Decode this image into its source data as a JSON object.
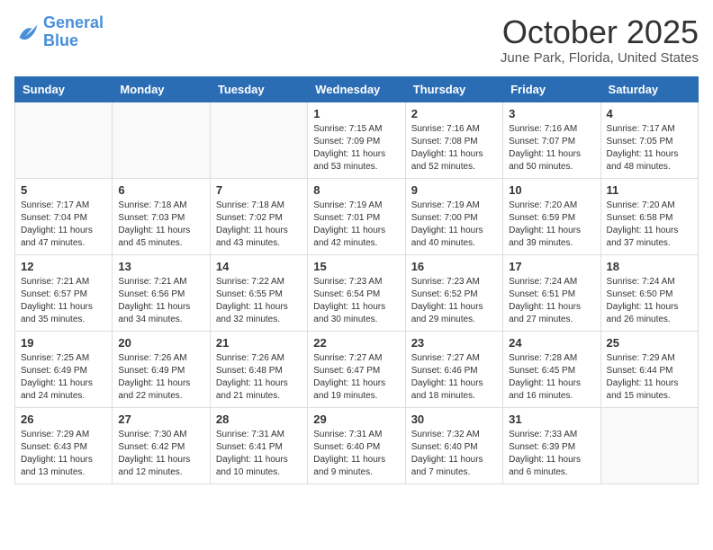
{
  "header": {
    "logo_line1": "General",
    "logo_line2": "Blue",
    "month": "October 2025",
    "location": "June Park, Florida, United States"
  },
  "weekdays": [
    "Sunday",
    "Monday",
    "Tuesday",
    "Wednesday",
    "Thursday",
    "Friday",
    "Saturday"
  ],
  "weeks": [
    [
      {
        "day": "",
        "info": ""
      },
      {
        "day": "",
        "info": ""
      },
      {
        "day": "",
        "info": ""
      },
      {
        "day": "1",
        "info": "Sunrise: 7:15 AM\nSunset: 7:09 PM\nDaylight: 11 hours and 53 minutes."
      },
      {
        "day": "2",
        "info": "Sunrise: 7:16 AM\nSunset: 7:08 PM\nDaylight: 11 hours and 52 minutes."
      },
      {
        "day": "3",
        "info": "Sunrise: 7:16 AM\nSunset: 7:07 PM\nDaylight: 11 hours and 50 minutes."
      },
      {
        "day": "4",
        "info": "Sunrise: 7:17 AM\nSunset: 7:05 PM\nDaylight: 11 hours and 48 minutes."
      }
    ],
    [
      {
        "day": "5",
        "info": "Sunrise: 7:17 AM\nSunset: 7:04 PM\nDaylight: 11 hours and 47 minutes."
      },
      {
        "day": "6",
        "info": "Sunrise: 7:18 AM\nSunset: 7:03 PM\nDaylight: 11 hours and 45 minutes."
      },
      {
        "day": "7",
        "info": "Sunrise: 7:18 AM\nSunset: 7:02 PM\nDaylight: 11 hours and 43 minutes."
      },
      {
        "day": "8",
        "info": "Sunrise: 7:19 AM\nSunset: 7:01 PM\nDaylight: 11 hours and 42 minutes."
      },
      {
        "day": "9",
        "info": "Sunrise: 7:19 AM\nSunset: 7:00 PM\nDaylight: 11 hours and 40 minutes."
      },
      {
        "day": "10",
        "info": "Sunrise: 7:20 AM\nSunset: 6:59 PM\nDaylight: 11 hours and 39 minutes."
      },
      {
        "day": "11",
        "info": "Sunrise: 7:20 AM\nSunset: 6:58 PM\nDaylight: 11 hours and 37 minutes."
      }
    ],
    [
      {
        "day": "12",
        "info": "Sunrise: 7:21 AM\nSunset: 6:57 PM\nDaylight: 11 hours and 35 minutes."
      },
      {
        "day": "13",
        "info": "Sunrise: 7:21 AM\nSunset: 6:56 PM\nDaylight: 11 hours and 34 minutes."
      },
      {
        "day": "14",
        "info": "Sunrise: 7:22 AM\nSunset: 6:55 PM\nDaylight: 11 hours and 32 minutes."
      },
      {
        "day": "15",
        "info": "Sunrise: 7:23 AM\nSunset: 6:54 PM\nDaylight: 11 hours and 30 minutes."
      },
      {
        "day": "16",
        "info": "Sunrise: 7:23 AM\nSunset: 6:52 PM\nDaylight: 11 hours and 29 minutes."
      },
      {
        "day": "17",
        "info": "Sunrise: 7:24 AM\nSunset: 6:51 PM\nDaylight: 11 hours and 27 minutes."
      },
      {
        "day": "18",
        "info": "Sunrise: 7:24 AM\nSunset: 6:50 PM\nDaylight: 11 hours and 26 minutes."
      }
    ],
    [
      {
        "day": "19",
        "info": "Sunrise: 7:25 AM\nSunset: 6:49 PM\nDaylight: 11 hours and 24 minutes."
      },
      {
        "day": "20",
        "info": "Sunrise: 7:26 AM\nSunset: 6:49 PM\nDaylight: 11 hours and 22 minutes."
      },
      {
        "day": "21",
        "info": "Sunrise: 7:26 AM\nSunset: 6:48 PM\nDaylight: 11 hours and 21 minutes."
      },
      {
        "day": "22",
        "info": "Sunrise: 7:27 AM\nSunset: 6:47 PM\nDaylight: 11 hours and 19 minutes."
      },
      {
        "day": "23",
        "info": "Sunrise: 7:27 AM\nSunset: 6:46 PM\nDaylight: 11 hours and 18 minutes."
      },
      {
        "day": "24",
        "info": "Sunrise: 7:28 AM\nSunset: 6:45 PM\nDaylight: 11 hours and 16 minutes."
      },
      {
        "day": "25",
        "info": "Sunrise: 7:29 AM\nSunset: 6:44 PM\nDaylight: 11 hours and 15 minutes."
      }
    ],
    [
      {
        "day": "26",
        "info": "Sunrise: 7:29 AM\nSunset: 6:43 PM\nDaylight: 11 hours and 13 minutes."
      },
      {
        "day": "27",
        "info": "Sunrise: 7:30 AM\nSunset: 6:42 PM\nDaylight: 11 hours and 12 minutes."
      },
      {
        "day": "28",
        "info": "Sunrise: 7:31 AM\nSunset: 6:41 PM\nDaylight: 11 hours and 10 minutes."
      },
      {
        "day": "29",
        "info": "Sunrise: 7:31 AM\nSunset: 6:40 PM\nDaylight: 11 hours and 9 minutes."
      },
      {
        "day": "30",
        "info": "Sunrise: 7:32 AM\nSunset: 6:40 PM\nDaylight: 11 hours and 7 minutes."
      },
      {
        "day": "31",
        "info": "Sunrise: 7:33 AM\nSunset: 6:39 PM\nDaylight: 11 hours and 6 minutes."
      },
      {
        "day": "",
        "info": ""
      }
    ]
  ]
}
